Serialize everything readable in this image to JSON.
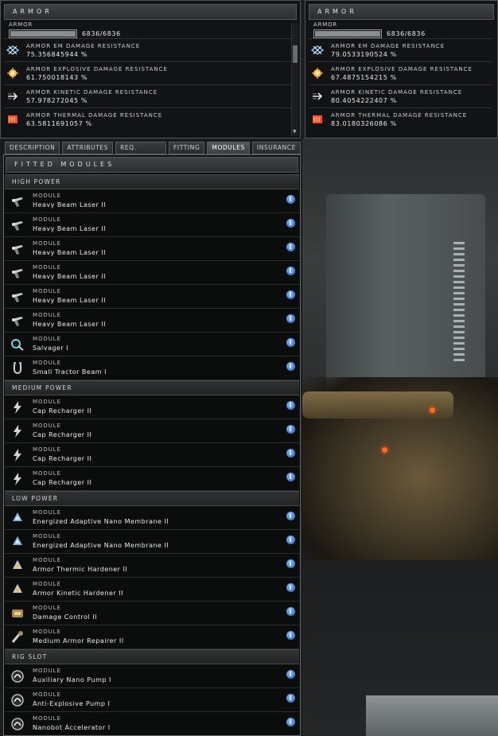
{
  "armor_left": {
    "title": "ARMOR",
    "sub_label": "ARMOR",
    "hp_value": "6836/6836",
    "hp_fill": 1.0,
    "resistances": [
      {
        "label": "ARMOR EM DAMAGE RESISTANCE",
        "value": "75.356845944 %",
        "icon": "em-damage-icon",
        "color": "#7ec8ff"
      },
      {
        "label": "ARMOR EXPLOSIVE DAMAGE RESISTANCE",
        "value": "61.750018143 %",
        "icon": "explosive-damage-icon",
        "color": "#ffb14a"
      },
      {
        "label": "ARMOR KINETIC DAMAGE RESISTANCE",
        "value": "57.978272045 %",
        "icon": "kinetic-damage-icon",
        "color": "#e8e8e8"
      },
      {
        "label": "ARMOR THERMAL DAMAGE RESISTANCE",
        "value": "63.5811691057 %",
        "icon": "thermal-damage-icon",
        "color": "#ff4a2a"
      }
    ]
  },
  "armor_right": {
    "title": "ARMOR",
    "sub_label": "ARMOR",
    "hp_value": "6836/6836",
    "hp_fill": 1.0,
    "resistances": [
      {
        "label": "ARMOR EM DAMAGE RESISTANCE",
        "value": "79.0533190524 %",
        "icon": "em-damage-icon",
        "color": "#7ec8ff"
      },
      {
        "label": "ARMOR EXPLOSIVE DAMAGE RESISTANCE",
        "value": "67.4875154215 %",
        "icon": "explosive-damage-icon",
        "color": "#ffb14a"
      },
      {
        "label": "ARMOR KINETIC DAMAGE RESISTANCE",
        "value": "80.4054222407 %",
        "icon": "kinetic-damage-icon",
        "color": "#e8e8e8"
      },
      {
        "label": "ARMOR THERMAL DAMAGE RESISTANCE",
        "value": "83.0180326086 %",
        "icon": "thermal-damage-icon",
        "color": "#ff4a2a"
      }
    ]
  },
  "tabs": [
    {
      "label": "DESCRIPTION",
      "active": false
    },
    {
      "label": "ATTRIBUTES",
      "active": false
    },
    {
      "label": "REQ. SKILLS",
      "active": false
    },
    {
      "label": "FITTING",
      "active": false
    },
    {
      "label": "MODULES",
      "active": true
    },
    {
      "label": "INSURANCE",
      "active": false
    }
  ],
  "modules_panel": {
    "title": "FITTED MODULES",
    "sections": [
      {
        "label": "HIGH POWER",
        "items": [
          {
            "type": "MODULE",
            "name": "Heavy Beam Laser II",
            "icon": "laser-turret-icon"
          },
          {
            "type": "MODULE",
            "name": "Heavy Beam Laser II",
            "icon": "laser-turret-icon"
          },
          {
            "type": "MODULE",
            "name": "Heavy Beam Laser II",
            "icon": "laser-turret-icon"
          },
          {
            "type": "MODULE",
            "name": "Heavy Beam Laser II",
            "icon": "laser-turret-icon"
          },
          {
            "type": "MODULE",
            "name": "Heavy Beam Laser II",
            "icon": "laser-turret-icon"
          },
          {
            "type": "MODULE",
            "name": "Heavy Beam Laser II",
            "icon": "laser-turret-icon"
          },
          {
            "type": "MODULE",
            "name": "Salvager I",
            "icon": "salvager-icon"
          },
          {
            "type": "MODULE",
            "name": "Small Tractor Beam I",
            "icon": "tractor-beam-icon"
          }
        ]
      },
      {
        "label": "MEDIUM POWER",
        "items": [
          {
            "type": "MODULE",
            "name": "Cap Recharger II",
            "icon": "cap-recharger-icon"
          },
          {
            "type": "MODULE",
            "name": "Cap Recharger II",
            "icon": "cap-recharger-icon"
          },
          {
            "type": "MODULE",
            "name": "Cap Recharger II",
            "icon": "cap-recharger-icon"
          },
          {
            "type": "MODULE",
            "name": "Cap Recharger II",
            "icon": "cap-recharger-icon"
          }
        ]
      },
      {
        "label": "LOW POWER",
        "items": [
          {
            "type": "MODULE",
            "name": "Energized Adaptive Nano Membrane II",
            "icon": "nano-membrane-icon"
          },
          {
            "type": "MODULE",
            "name": "Energized Adaptive Nano Membrane II",
            "icon": "nano-membrane-icon"
          },
          {
            "type": "MODULE",
            "name": "Armor Thermic Hardener II",
            "icon": "armor-hardener-icon"
          },
          {
            "type": "MODULE",
            "name": "Armor Kinetic Hardener II",
            "icon": "armor-hardener-icon"
          },
          {
            "type": "MODULE",
            "name": "Damage Control II",
            "icon": "damage-control-icon"
          },
          {
            "type": "MODULE",
            "name": "Medium Armor Repairer II",
            "icon": "armor-repairer-icon"
          }
        ]
      },
      {
        "label": "RIG SLOT",
        "items": [
          {
            "type": "MODULE",
            "name": "Auxiliary Nano Pump I",
            "icon": "rig-icon"
          },
          {
            "type": "MODULE",
            "name": "Anti-Explosive Pump I",
            "icon": "rig-icon"
          },
          {
            "type": "MODULE",
            "name": "Nanobot Accelerator I",
            "icon": "rig-icon"
          }
        ]
      }
    ]
  },
  "info_glyph": "i",
  "colors": {
    "accent_info": "#2f6fd6",
    "panel_bg": "#0d0e0f",
    "header_bg": "#3a3c3d"
  }
}
